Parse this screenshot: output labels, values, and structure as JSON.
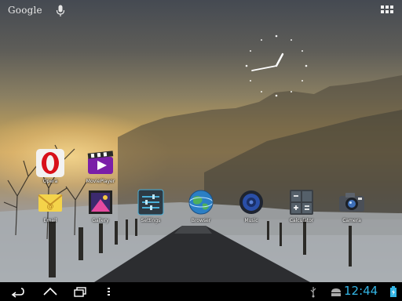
{
  "search": {
    "label": "Google"
  },
  "apps": [
    {
      "id": "opera",
      "label": "Opera"
    },
    {
      "id": "movieplayer",
      "label": "MoviePlayer"
    },
    {
      "id": "email",
      "label": "Email"
    },
    {
      "id": "gallery",
      "label": "Gallery"
    },
    {
      "id": "settings",
      "label": "Settings"
    },
    {
      "id": "browser",
      "label": "Browser"
    },
    {
      "id": "music",
      "label": "Music"
    },
    {
      "id": "calculator",
      "label": "Calculator"
    },
    {
      "id": "camera",
      "label": "Camera"
    }
  ],
  "status": {
    "time": "12:44",
    "accent": "#33b5e5"
  },
  "icons": [
    "mic-icon",
    "apps-grid-icon",
    "clock-widget",
    "back-icon",
    "home-icon",
    "recent-apps-icon",
    "menu-icon",
    "usb-icon",
    "android-debug-icon",
    "battery-icon"
  ]
}
